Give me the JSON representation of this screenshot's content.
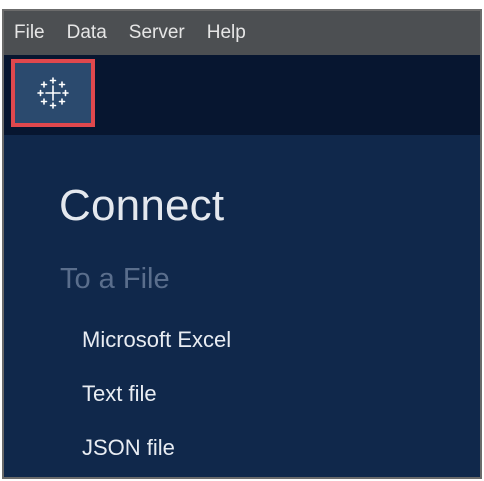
{
  "menubar": {
    "items": [
      {
        "label": "File"
      },
      {
        "label": "Data"
      },
      {
        "label": "Server"
      },
      {
        "label": "Help"
      }
    ]
  },
  "toolbar": {
    "logo_icon": "tableau-logo-icon",
    "highlight_color": "#e0484d"
  },
  "connect": {
    "title": "Connect",
    "section_title": "To a File",
    "items": [
      {
        "label": "Microsoft Excel"
      },
      {
        "label": "Text file"
      },
      {
        "label": "JSON file"
      }
    ]
  },
  "colors": {
    "panel_bg": "#10284b",
    "toolbar_bg": "#071630",
    "menubar_bg": "#4c4f52"
  }
}
